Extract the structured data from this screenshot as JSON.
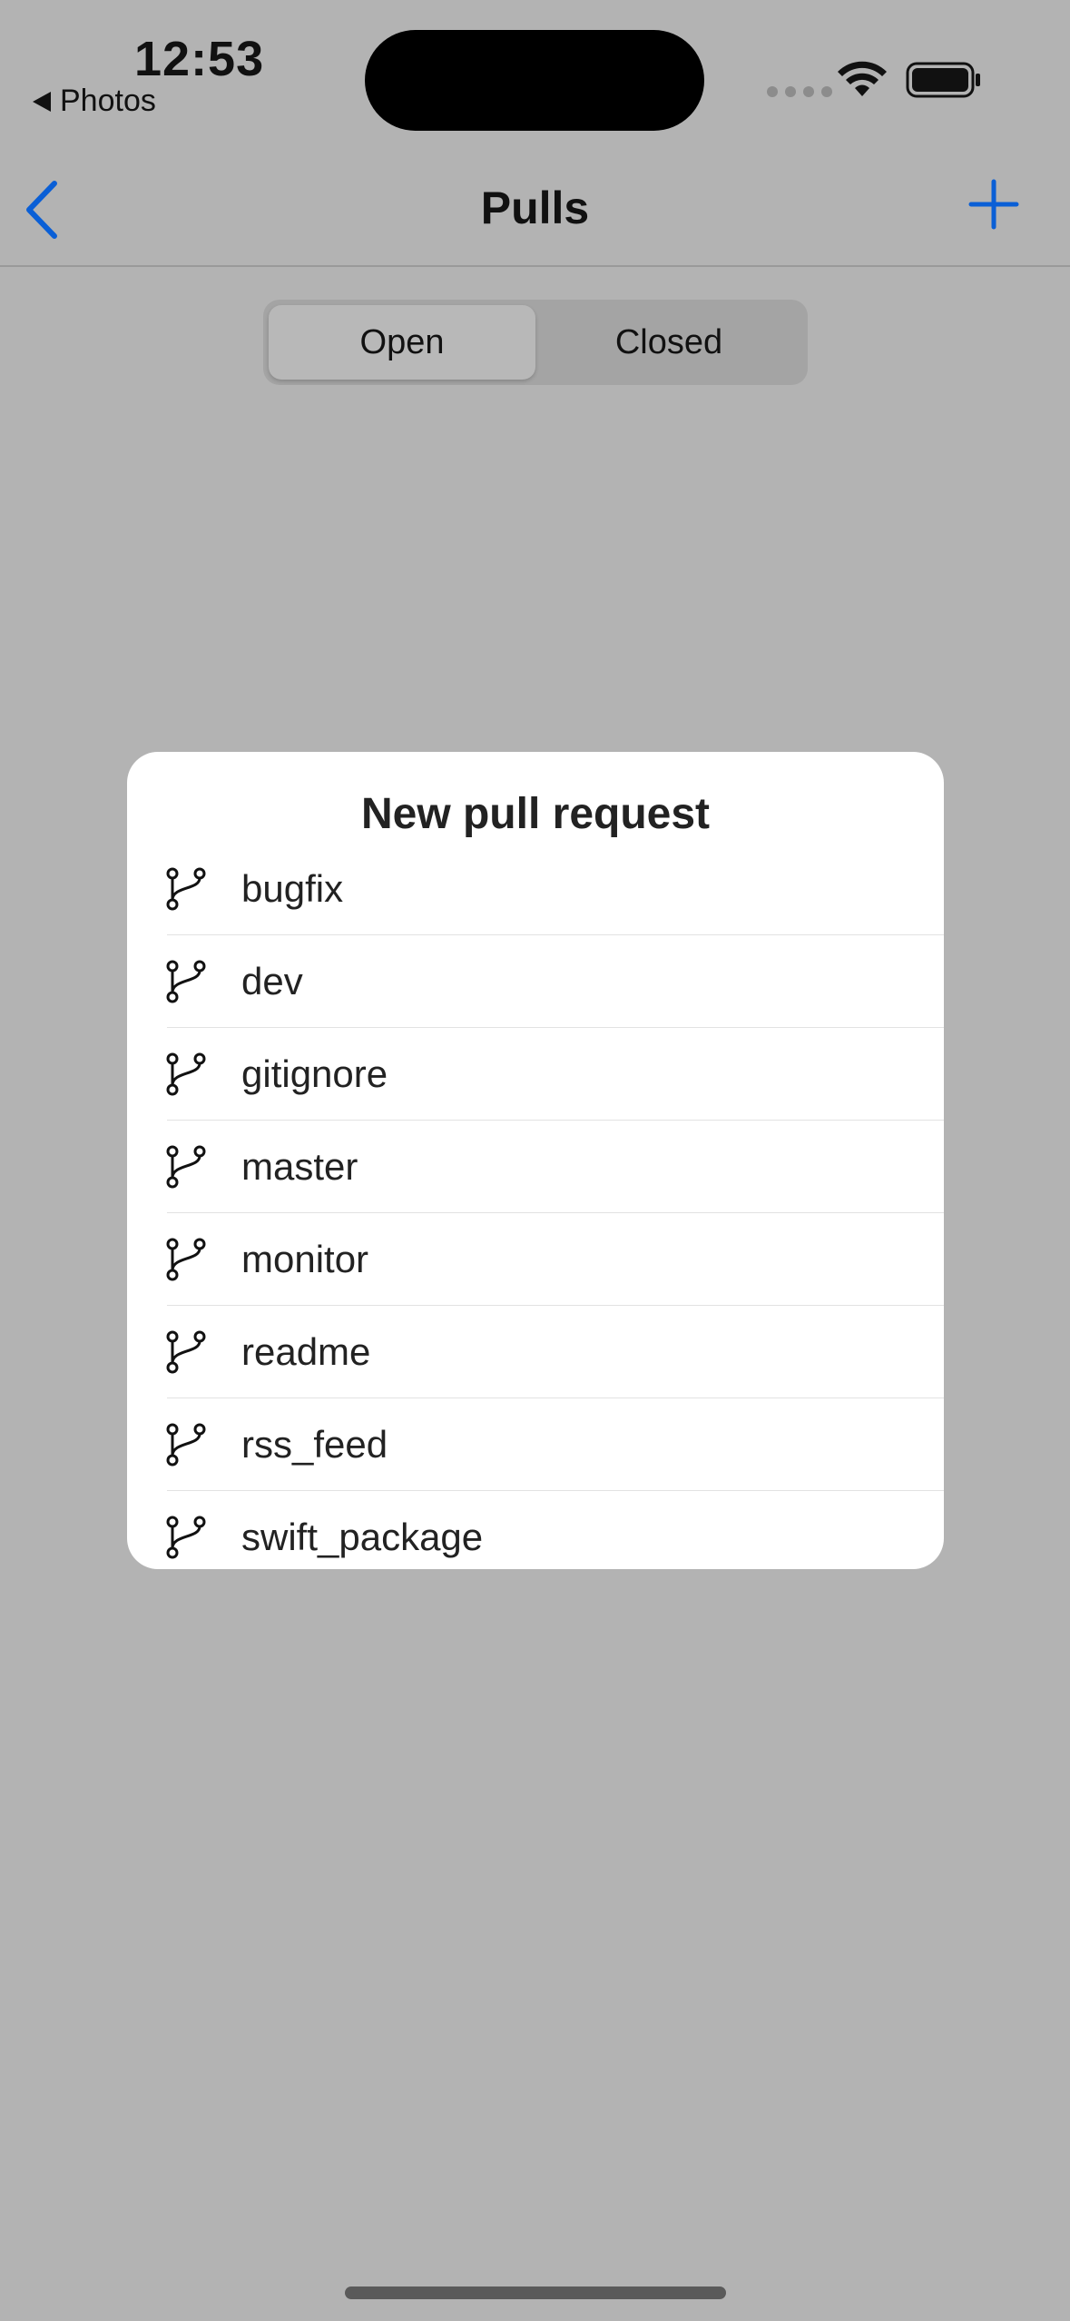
{
  "status_bar": {
    "time": "12:53",
    "back_app": "Photos"
  },
  "nav": {
    "title": "Pulls",
    "back_icon": "chevron-left-icon",
    "add_icon": "plus-icon",
    "accent_color": "#0a5fd6"
  },
  "segmented": {
    "options": [
      "Open",
      "Closed"
    ],
    "selected": "Open"
  },
  "popup": {
    "title": "New pull request",
    "branch_icon": "git-branch-icon",
    "branches": [
      "bugfix",
      "dev",
      "gitignore",
      "master",
      "monitor",
      "readme",
      "rss_feed",
      "swift_package"
    ]
  }
}
